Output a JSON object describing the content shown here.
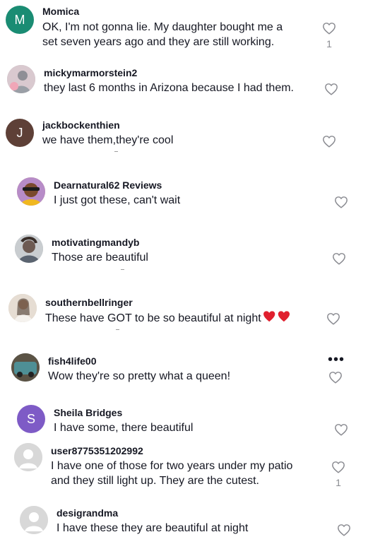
{
  "comments": [
    {
      "username": "Momica",
      "lines": [
        "OK, I'm not gonna lie. My daughter bought me a",
        "set seven years ago and they are still working."
      ],
      "avatar_letter": "M",
      "avatar_color": "#1a8c73",
      "like_count": "1"
    },
    {
      "username": "mickymarmorstein2",
      "lines": [
        "they last 6 months in Arizona because I had them."
      ],
      "avatar_letter": "",
      "avatar_color": "#b9a9b2",
      "like_count": ""
    },
    {
      "username": "jackbockenthien",
      "lines": [
        "we have them,they're cool"
      ],
      "avatar_letter": "J",
      "avatar_color": "#5e4037",
      "like_count": ""
    },
    {
      "username": "Dearnatural62 Reviews",
      "lines": [
        "I just got these, can't wait"
      ],
      "avatar_letter": "",
      "avatar_color": "#c79063",
      "like_count": ""
    },
    {
      "username": "motivatingmandyb",
      "lines": [
        "Those are beautiful"
      ],
      "avatar_letter": "",
      "avatar_color": "#9aa3a9",
      "like_count": ""
    },
    {
      "username": "southernbellringer",
      "lines": [
        "These have GOT to be so beautiful at night"
      ],
      "avatar_letter": "",
      "avatar_color": "#cfc2b3",
      "like_count": ""
    },
    {
      "username": "fish4life00",
      "lines": [
        "Wow they're so pretty what a queen!"
      ],
      "avatar_letter": "",
      "avatar_color": "#5c6b6d",
      "like_count": ""
    },
    {
      "username": "Sheila Bridges",
      "lines": [
        "I have some, there beautiful"
      ],
      "avatar_letter": "S",
      "avatar_color": "#7e5bc6",
      "like_count": ""
    },
    {
      "username": "user8775351202992",
      "lines": [
        "I have one of those for two years under my patio",
        "and they still light up. They are the cutest."
      ],
      "avatar_letter": "",
      "avatar_color": "#d8d8d8",
      "like_count": "1"
    },
    {
      "username": "desigrandma",
      "lines": [
        "I have these they are beautiful at night"
      ],
      "avatar_letter": "",
      "avatar_color": "#d8d8d8",
      "like_count": ""
    }
  ],
  "colors": {
    "heart_outline": "#8a8b91",
    "heart_red": "#e0202e",
    "text": "#161823"
  },
  "icons": {
    "like": "heart-outline-icon",
    "more": "more-options-icon",
    "emoji": "red-heart-emoji"
  }
}
